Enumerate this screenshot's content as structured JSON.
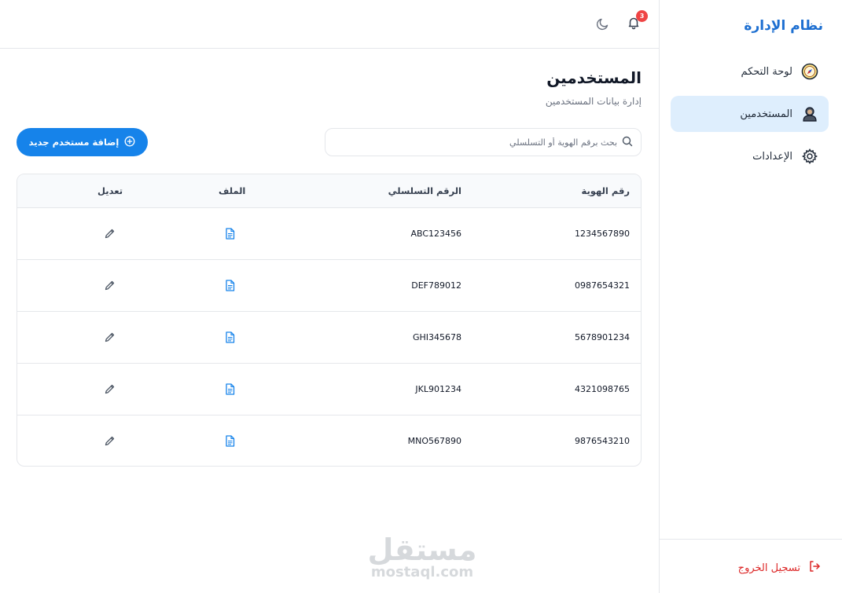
{
  "sidebar": {
    "brand": "نظام الإدارة",
    "items": [
      {
        "label": "لوحة التحكم",
        "icon": "compass-icon",
        "active": false
      },
      {
        "label": "المستخدمين",
        "icon": "user-icon",
        "active": true
      },
      {
        "label": "الإعدادات",
        "icon": "gear-icon",
        "active": false
      }
    ],
    "logout_label": "تسجيل الخروج"
  },
  "topbar": {
    "notifications_count": "3"
  },
  "page": {
    "title": "المستخدمين",
    "subtitle": "إدارة بيانات المستخدمين"
  },
  "search": {
    "placeholder": "بحث برقم الهوية أو التسلسلي"
  },
  "add_button": {
    "label": "إضافة مستخدم جديد"
  },
  "table": {
    "headers": {
      "id": "رقم الهوية",
      "serial": "الرقم التسلسلي",
      "file": "الملف",
      "edit": "تعديل"
    },
    "rows": [
      {
        "id": "1234567890",
        "serial": "ABC123456"
      },
      {
        "id": "0987654321",
        "serial": "DEF789012"
      },
      {
        "id": "5678901234",
        "serial": "GHI345678"
      },
      {
        "id": "4321098765",
        "serial": "JKL901234"
      },
      {
        "id": "9876543210",
        "serial": "MNO567890"
      }
    ]
  },
  "watermark": {
    "arabic": "مستقل",
    "latin": "mostaql.com"
  },
  "colors": {
    "accent": "#1683ea",
    "brand": "#1d6fd1",
    "active_bg": "#deeefd",
    "danger": "#dc2626",
    "badge": "#ef4444"
  }
}
